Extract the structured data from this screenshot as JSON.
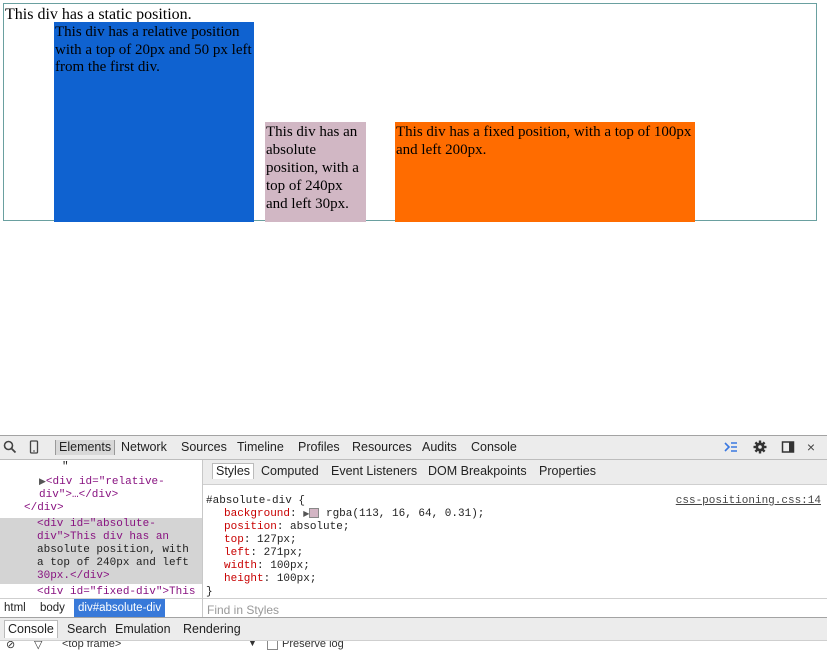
{
  "page": {
    "static_text": "This div has a static position.",
    "relative_text": "This div has a relative position with a top of 20px and 50 px left from the first div.",
    "absolute_text": "This div has an absolute position, with a top of 240px and left 30px.",
    "fixed_text": "This div has a fixed position, with a top of 100px and left 200px."
  },
  "devtools": {
    "tabs": [
      "Elements",
      "Network",
      "Sources",
      "Timeline",
      "Profiles",
      "Resources",
      "Audits",
      "Console"
    ],
    "icons": [
      "search-icon",
      "device-icon",
      "drawer-icon",
      "gear-icon",
      "dock-icon",
      "close-icon"
    ],
    "elements": {
      "lines": [
        "\"",
        "<div id=\"relative-",
        "div\">…</div>",
        "</div>",
        "<div id=\"absolute-",
        "div\">This div has an",
        "absolute position, with",
        "a top of 240px and left",
        "30px.</div>",
        "<div id=\"fixed-div\">This"
      ]
    },
    "breadcrumbs": [
      "html",
      "body",
      "div#absolute-div"
    ],
    "styles_tabs": [
      "Styles",
      "Computed",
      "Event Listeners",
      "DOM Breakpoints",
      "Properties"
    ],
    "rule": {
      "selector": "#absolute-div {",
      "source": "css-positioning.css:14",
      "properties": [
        {
          "name": "background",
          "value": "rgba(113, 16, 64, 0.31);"
        },
        {
          "name": "position",
          "value": "absolute;"
        },
        {
          "name": "top",
          "value": "127px;"
        },
        {
          "name": "left",
          "value": "271px;"
        },
        {
          "name": "width",
          "value": "100px;"
        },
        {
          "name": "height",
          "value": "100px;"
        }
      ],
      "close": "}"
    },
    "find_placeholder": "Find in Styles",
    "drawer_tabs": [
      "Console",
      "Search",
      "Emulation",
      "Rendering"
    ],
    "console_frame": "<top frame>",
    "preserve_log": "Preserve log"
  }
}
